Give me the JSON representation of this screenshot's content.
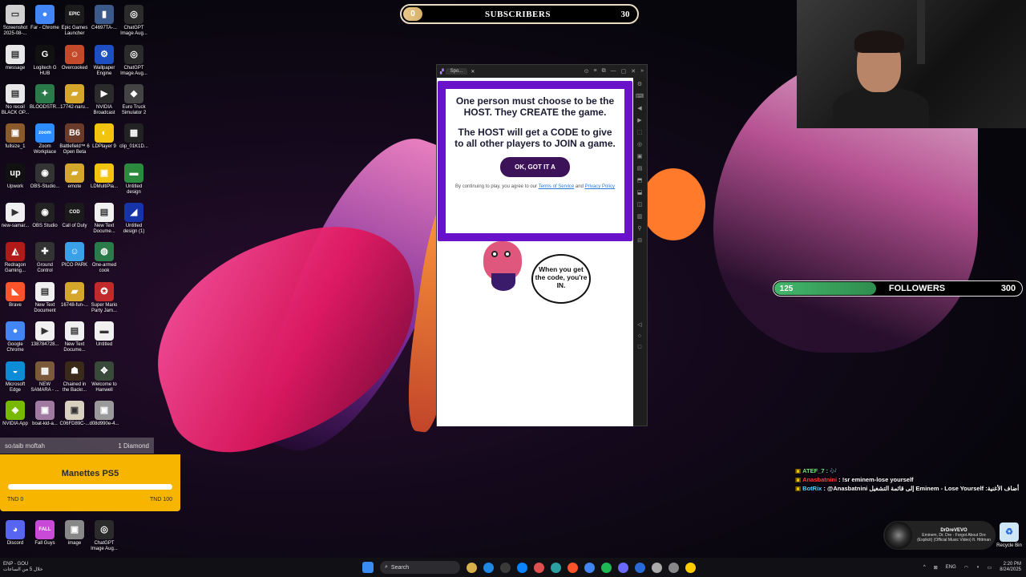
{
  "desktop": {
    "icons": [
      {
        "label": "Screenshot\n2025-08-...",
        "color": "#d0d0d0",
        "glyph": "▭"
      },
      {
        "label": "Far - Chrome",
        "color": "#4285f4",
        "glyph": "●"
      },
      {
        "label": "Epic Games\nLauncher",
        "color": "#1b1b1b",
        "glyph": "EPIC"
      },
      {
        "label": "C4697TA-...",
        "color": "#3b5a8a",
        "glyph": "▮"
      },
      {
        "label": "ChatGPT\nImage Aug...",
        "color": "#2b2b2b",
        "glyph": "◎"
      },
      {
        "label": "message",
        "color": "#e8e8e8",
        "glyph": "▤"
      },
      {
        "label": "Logitech G\nHUB",
        "color": "#111",
        "glyph": "G"
      },
      {
        "label": "Overcooked",
        "color": "#c24a2b",
        "glyph": "☺"
      },
      {
        "label": "Wallpaper\nEngine",
        "color": "#1e4fc2",
        "glyph": "⚙"
      },
      {
        "label": "ChatGPT\nImage Aug...",
        "color": "#2b2b2b",
        "glyph": "◎"
      },
      {
        "label": "No recoil\nBLACK OP...",
        "color": "#e8e8e8",
        "glyph": "▤"
      },
      {
        "label": "BLOODSTR...",
        "color": "#2a7a4a",
        "glyph": "✦"
      },
      {
        "label": "17742-naru...",
        "color": "#d4a72c",
        "glyph": "▰"
      },
      {
        "label": "NVIDIA\nBroadcast",
        "color": "#2b2b2b",
        "glyph": "▶"
      },
      {
        "label": "Euro Truck\nSimulator 2",
        "color": "#444",
        "glyph": "◆"
      },
      {
        "label": "fullsize_1",
        "color": "#8a5a2a",
        "glyph": "▣"
      },
      {
        "label": "Zoom\nWorkplace",
        "color": "#2d8cff",
        "glyph": "zoom"
      },
      {
        "label": "Battlefield™ 6\nOpen Beta",
        "color": "#6a3a2a",
        "glyph": "B6"
      },
      {
        "label": "LDPlayer 9",
        "color": "#f2c40f",
        "glyph": "◐"
      },
      {
        "label": "clip_01K1D...",
        "color": "#222",
        "glyph": "▦"
      },
      {
        "label": "Upwork",
        "color": "#111",
        "glyph": "up"
      },
      {
        "label": "OBS-Studio...",
        "color": "#333",
        "glyph": "◉"
      },
      {
        "label": "emote",
        "color": "#d4a72c",
        "glyph": "▰"
      },
      {
        "label": "LDMultiPla...",
        "color": "#f2c40f",
        "glyph": "▣"
      },
      {
        "label": "Untitled\ndesign",
        "color": "#2b8a3e",
        "glyph": "▬"
      },
      {
        "label": "new-samar...",
        "color": "#f0f0f0",
        "glyph": "▶"
      },
      {
        "label": "OBS Studio",
        "color": "#222",
        "glyph": "◉"
      },
      {
        "label": "Call of Duty",
        "color": "#1a1a1a",
        "glyph": "COD"
      },
      {
        "label": "New Text\nDocume...",
        "color": "#f0f0f0",
        "glyph": "▤"
      },
      {
        "label": "Untitled\ndesign (1)",
        "color": "#1733a8",
        "glyph": "◢"
      },
      {
        "label": "Redragon\nGaming...",
        "color": "#b21a1a",
        "glyph": "◭"
      },
      {
        "label": "Ground\nControl",
        "color": "#333",
        "glyph": "✚"
      },
      {
        "label": "PICO PARK",
        "color": "#3aa0e8",
        "glyph": "☺"
      },
      {
        "label": "One-armed\ncook",
        "color": "#2a7a4a",
        "glyph": "◍"
      },
      {
        "label": "",
        "color": "transparent",
        "glyph": ""
      },
      {
        "label": "Brave",
        "color": "#fb542b",
        "glyph": "◣"
      },
      {
        "label": "New Text\nDocument",
        "color": "#f0f0f0",
        "glyph": "▤"
      },
      {
        "label": "16748-fun-...",
        "color": "#d4a72c",
        "glyph": "▰"
      },
      {
        "label": "Super Mario\nParty Jam...",
        "color": "#c02a2a",
        "glyph": "✪"
      },
      {
        "label": "",
        "color": "transparent",
        "glyph": ""
      },
      {
        "label": "Google\nChrome",
        "color": "#4285f4",
        "glyph": "●"
      },
      {
        "label": "138784728...",
        "color": "#f0f0f0",
        "glyph": "▶"
      },
      {
        "label": "New Text\nDocume...",
        "color": "#f0f0f0",
        "glyph": "▤"
      },
      {
        "label": "Untitled",
        "color": "#f0f0f0",
        "glyph": "▬"
      },
      {
        "label": "",
        "color": "transparent",
        "glyph": ""
      },
      {
        "label": "Microsoft\nEdge",
        "color": "#0c8bd6",
        "glyph": "◒"
      },
      {
        "label": "NEW\nSAMARA - ...",
        "color": "#7a5a3a",
        "glyph": "▦"
      },
      {
        "label": "Chained in\nthe Backr...",
        "color": "#3a2a1a",
        "glyph": "☗"
      },
      {
        "label": "Welcome to\nHanwell",
        "color": "#3a4a3a",
        "glyph": "✥"
      },
      {
        "label": "",
        "color": "transparent",
        "glyph": ""
      },
      {
        "label": "NVIDIA App",
        "color": "#76b900",
        "glyph": "◈"
      },
      {
        "label": "boat-kid-a...",
        "color": "#a07aa0",
        "glyph": "▣"
      },
      {
        "label": "C06FD89C-...",
        "color": "#d9d0c0",
        "glyph": "▣"
      },
      {
        "label": "d08d990e-4...",
        "color": "#9a9a9a",
        "glyph": "▣"
      },
      {
        "label": "",
        "color": "transparent",
        "glyph": ""
      },
      {
        "label": "Discord",
        "color": "#5865f2",
        "glyph": "◕"
      },
      {
        "label": "Fall Guys",
        "color": "#c84ad6",
        "glyph": "FALL"
      },
      {
        "label": "image",
        "color": "#888",
        "glyph": "▣"
      },
      {
        "label": "ChatGPT\nImage Aug...",
        "color": "#2b2b2b",
        "glyph": "◎"
      }
    ]
  },
  "subscribers": {
    "current": "0",
    "title": "SUBSCRIBERS",
    "goal": "30",
    "progress_fraction": 0.08
  },
  "followers": {
    "current": "125",
    "title": "FOLLOWERS",
    "goal": "300",
    "progress_fraction": 0.41
  },
  "window": {
    "tab_title": "Spo...",
    "controls": [
      "⊙",
      "≡",
      "⧉",
      "—",
      "▢",
      "✕",
      "»"
    ],
    "side_tools": [
      "⚙",
      "⌨",
      "◀",
      "▶",
      "⬚",
      "◎",
      "▣",
      "▤",
      "⬒",
      "⬓",
      "◫",
      "▥",
      "⚲",
      "⊟",
      "◁",
      "○",
      "□"
    ]
  },
  "modal": {
    "para1": "One person must choose to be the HOST. They CREATE the game.",
    "para2": "The HOST will get a CODE to give to all other players to JOIN a game.",
    "ok_label": "OK, GOT IT A",
    "fine_prefix": "By continuing to play, you agree to our",
    "terms_label": "Terms of Service",
    "and_label": "and",
    "privacy_label": "Privacy Policy"
  },
  "bubble": {
    "text": "When you get the code, you're IN."
  },
  "donation": {
    "header_left": "so₍taib moftah",
    "header_right": "1 Diamond",
    "title": "Manettes PS5",
    "low": "TND 0",
    "high": "TND 100",
    "progress_fraction": 0.0
  },
  "chat": [
    {
      "user": "ATEF_7 :",
      "msg": " 🎶",
      "cls": "u1"
    },
    {
      "user": "Anasbatnini",
      "msg": " : !sr eminem-lose yourself",
      "cls": "u2"
    },
    {
      "user": "BotRix",
      "msg": " : @Anasbatnini إلى قائمة التشغيل Eminem - Lose Yourself :أضاف الأغنية",
      "cls": "u3"
    }
  ],
  "now_playing": {
    "artist": "DrDreVEVO",
    "track": "Eminem, Dr. Dre - Forgot About Dre (Explicit) (Official Music Video) ft. Hittman"
  },
  "taskbar": {
    "left_line1": "ENP - GOU",
    "left_line2": "خلال 5 من الساعات",
    "search_label": "Search",
    "lang": "ENG",
    "time": "2:20 PM",
    "date": "8/24/2025",
    "recycle_label": "Recycle Bin",
    "app_colors": [
      "#d8b14a",
      "#1e88e5",
      "#3a3a3a",
      "#0a84ff",
      "#e05050",
      "#2aa0a0",
      "#fb542b",
      "#4285f4",
      "#1db954",
      "#6a6aff",
      "#2a6ad6",
      "#aaaaaa",
      "#888888",
      "#ffcc00"
    ]
  }
}
